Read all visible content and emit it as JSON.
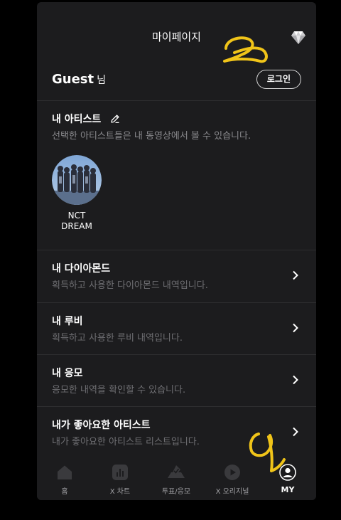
{
  "header": {
    "title": "마이페이지",
    "diamond_icon": "diamond-icon"
  },
  "profile": {
    "name": "Guest",
    "suffix": "님",
    "login_label": "로그인"
  },
  "my_artists": {
    "title": "내 아티스트",
    "edit_icon": "pencil-icon",
    "description": "선택한 아티스트들은 내 동영상에서 볼 수 있습니다.",
    "artists": [
      {
        "name_line1": "NCT",
        "name_line2": "DREAM"
      }
    ]
  },
  "menu": [
    {
      "title": "내 다이아몬드",
      "desc": "획득하고 사용한 다이아몬드 내역입니다."
    },
    {
      "title": "내 루비",
      "desc": "획득하고 사용한 루비 내역입니다."
    },
    {
      "title": "내 응모",
      "desc": "응모한 내역을 확인할 수 있습니다."
    },
    {
      "title": "내가 좋아요한 아티스트",
      "desc": "내가 좋아요한 아티스트 리스트입니다."
    }
  ],
  "tabbar": {
    "active": "MY",
    "tabs": [
      {
        "label": "홈",
        "icon": "home-icon"
      },
      {
        "label": "X 차트",
        "icon": "chart-icon"
      },
      {
        "label": "투표/응모",
        "icon": "vote-icon"
      },
      {
        "label": "X 오리지널",
        "icon": "play-icon"
      },
      {
        "label": "MY",
        "icon": "profile-icon"
      }
    ]
  },
  "colors": {
    "background": "#1c1c1e",
    "divider": "#2e2e30",
    "muted_text": "#6f6f73",
    "annotation": "#f0c419"
  }
}
